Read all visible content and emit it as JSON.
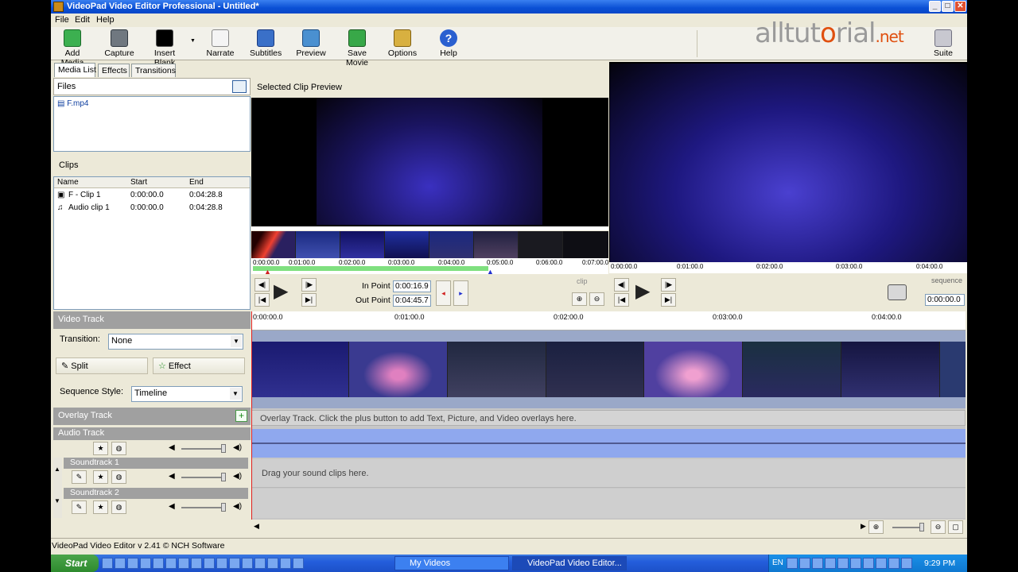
{
  "window": {
    "title": "VideoPad Video Editor Professional - Untitled*",
    "minimize": "_",
    "maximize": "□",
    "close": "✕"
  },
  "menu": [
    "File",
    "Edit",
    "Help"
  ],
  "toolbar": {
    "add_media": "Add Media",
    "capture": "Capture",
    "insert_blank": "Insert Blank",
    "narrate": "Narrate",
    "subtitles": "Subtitles",
    "preview": "Preview",
    "save_movie": "Save Movie",
    "options": "Options",
    "help": "Help",
    "suite": "Suite"
  },
  "watermark": {
    "brand": "alltut",
    "brand2": "rial",
    "tld": ".net"
  },
  "tabs": [
    "Media List",
    "Effects",
    "Transitions"
  ],
  "files": {
    "header": "Files",
    "items": [
      "F.mp4"
    ]
  },
  "clips": {
    "header": "Clips",
    "columns": [
      "Name",
      "Start",
      "End"
    ],
    "rows": [
      {
        "name": "F - Clip 1",
        "start": "0:00:00.0",
        "end": "0:04:28.8"
      },
      {
        "name": "Audio clip 1",
        "start": "0:00:00.0",
        "end": "0:04:28.8"
      }
    ]
  },
  "clip_preview": {
    "header": "Selected Clip Preview",
    "ruler": [
      "0:00:00.0",
      "0:01:00.0",
      "0:02:00.0",
      "0:03:00.0",
      "0:04:00.0",
      "0:05:00.0",
      "0:06:00.0",
      "0:07:00.0"
    ],
    "in_point_label": "In Point",
    "in_point": "0:00:16.9",
    "out_point_label": "Out Point",
    "out_point": "0:04:45.7",
    "mode": "clip"
  },
  "sequence_preview": {
    "ruler": [
      "0:00:00.0",
      "0:01:00.0",
      "0:02:00.0",
      "0:03:00.0",
      "0:04:00.0"
    ],
    "mode": "sequence",
    "timecode": "0:00:00.0"
  },
  "video_track": {
    "header": "Video Track",
    "transition_label": "Transition:",
    "transition_value": "None",
    "split": "Split",
    "effect": "Effect",
    "sequence_style_label": "Sequence Style:",
    "sequence_style_value": "Timeline"
  },
  "timeline": {
    "ruler": [
      "0:00:00.0",
      "0:01:00.0",
      "0:02:00.0",
      "0:03:00.0",
      "0:04:00.0"
    ],
    "overlay_hint": "Overlay Track. Click the plus button to add Text, Picture, and Video overlays here.",
    "sound_hint": "Drag your sound clips here."
  },
  "overlay_track": {
    "header": "Overlay Track"
  },
  "audio_track": {
    "header": "Audio Track"
  },
  "soundtracks": [
    "Soundtrack 1",
    "Soundtrack 2"
  ],
  "status": "VideoPad Video Editor v 2.41 © NCH Software",
  "taskbar": {
    "start": "Start",
    "items": [
      "My Videos",
      "VideoPad Video Editor..."
    ],
    "lang": "EN",
    "clock": "9:29 PM"
  },
  "colors": {
    "titlebar": "#0a4fd4",
    "face": "#ece9d8",
    "track_gray": "#a0a0a0",
    "audio_wave": "#8fa8ee",
    "green_range": "#7fe07f"
  }
}
